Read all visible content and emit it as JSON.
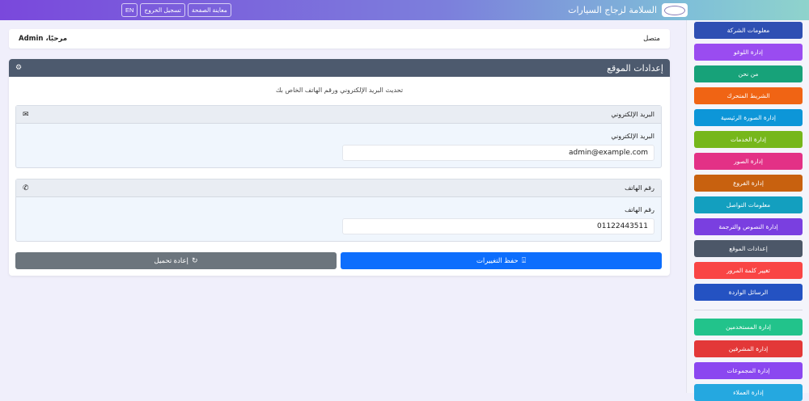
{
  "header": {
    "brand": "السلامة لزجاج السيارات",
    "buttons": [
      "معاينة الصفحة",
      "تسجيل الخروج",
      "EN"
    ]
  },
  "welcome": {
    "status": "متصل",
    "greeting": "مرحبًا، Admin"
  },
  "card": {
    "title": "إعدادات الموقع",
    "subtitle": "تحديث البريد الإلكتروني ورقم الهاتف الخاص بك",
    "email": {
      "section_title": "البريد الإلكتروني",
      "label": "البريد الإلكتروني",
      "value": "admin@example.com"
    },
    "phone": {
      "section_title": "رقم الهاتف",
      "label": "رقم الهاتف",
      "value": "01122443511"
    },
    "save_label": "حفظ التغييرات",
    "reload_label": "إعادة تحميل"
  },
  "sidebar": {
    "items": [
      {
        "label": "معلومات الشركة",
        "color": "#2f4fb3"
      },
      {
        "label": "إدارة اللوغو",
        "color": "#9a4cf0"
      },
      {
        "label": "من نحن",
        "color": "#17a279"
      },
      {
        "label": "الشريط المتحرك",
        "color": "#f06414"
      },
      {
        "label": "إدارة الصورة الرئيسية",
        "color": "#0d96d8"
      },
      {
        "label": "إدارة الخدمات",
        "color": "#76b71b"
      },
      {
        "label": "إدارة الصور",
        "color": "#e33186"
      },
      {
        "label": "إدارة الفروع",
        "color": "#c8610f"
      },
      {
        "label": "معلومات التواصل",
        "color": "#139fbf"
      },
      {
        "label": "إدارة النصوص والترجمة",
        "color": "#7a3fe0"
      },
      {
        "label": "إعدادات الموقع",
        "color": "#4c5768"
      },
      {
        "label": "تغيير كلمة المرور",
        "color": "#f94545"
      },
      {
        "label": "الرسائل الواردة",
        "color": "#2452c2"
      }
    ],
    "admin_items": [
      {
        "label": "إدارة المستخدمين",
        "color": "#22c38b"
      },
      {
        "label": "إدارة المشرفين",
        "color": "#e33838"
      },
      {
        "label": "إدارة المجموعات",
        "color": "#8b47f0"
      },
      {
        "label": "إدارة العملاء",
        "color": "#25a8e0"
      }
    ]
  }
}
